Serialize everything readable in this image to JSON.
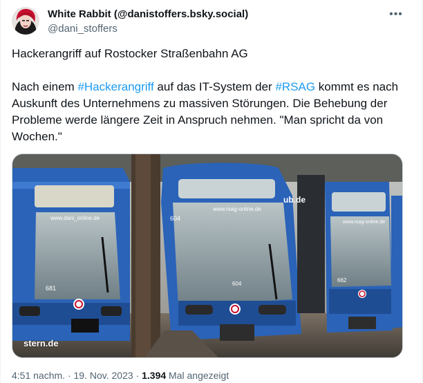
{
  "post": {
    "author_name": "White Rabbit (@danistoffers.bsky.social)",
    "author_handle": "@dani_stoffers",
    "more_icon": "more-horizontal-icon",
    "headline": "Hackerangriff auf Rostocker Straßenbahn AG",
    "body": {
      "part1": "Nach einem ",
      "hashtag1": "#Hackerangriff",
      "part2": " auf das IT-System der ",
      "hashtag2": "#RSAG",
      "part3": " kommt es nach Auskunft des Unternehmens zu massiven Störungen. Die Behebung der Probleme werde längere Zeit in Anspruch nehmen. \"Man spricht da von Wochen.\""
    },
    "media": {
      "watermark": "stern.de",
      "tram_labels": [
        "www.dani_online.de",
        "www.rsag-online.de",
        "www.rsag-online.de",
        "ub.de"
      ],
      "tram_numbers": [
        "681",
        "604",
        "604",
        "662"
      ]
    },
    "meta": {
      "time": "4:51 nachm.",
      "sep1": " · ",
      "date": "19. Nov. 2023",
      "sep2": " · ",
      "views": "1.394",
      "views_label": " Mal angezeigt"
    },
    "colors": {
      "hashtag": "#1d9bf0",
      "secondary": "#536471",
      "tram_blue": "#2a63b8"
    }
  }
}
